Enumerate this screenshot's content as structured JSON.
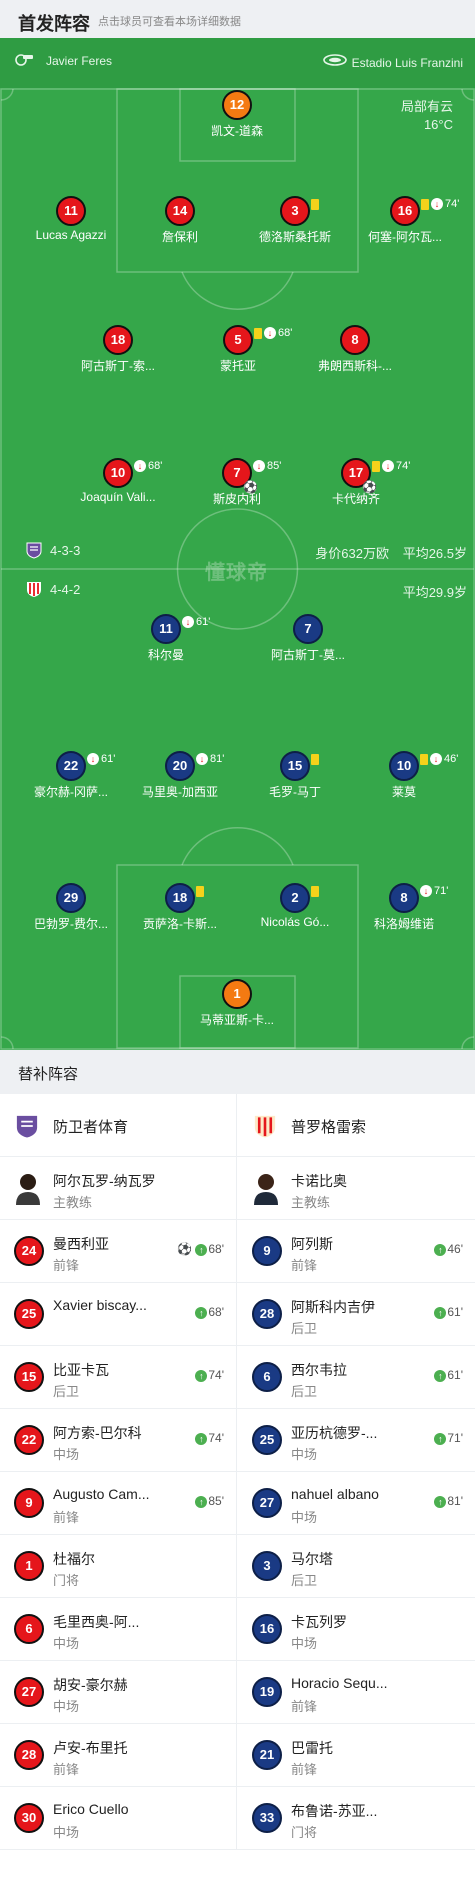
{
  "header": {
    "title": "首发阵容",
    "hint": "点击球员可查看本场详细数据"
  },
  "match_info": {
    "referee": "Javier Feres",
    "stadium": "Estadio Luis Franzini",
    "weather": "局部有云",
    "temperature": "16°C",
    "watermark": "懂球帝"
  },
  "home_team": {
    "name": "防卫者体育",
    "formation": "4-3-3",
    "value": "身价632万欧",
    "avg_age": "平均26.5岁",
    "color": "#e5161b"
  },
  "away_team": {
    "name": "普罗格雷索",
    "formation": "4-4-2",
    "avg_age": "平均29.9岁",
    "color": "#1a3a84"
  },
  "home_lineup": [
    {
      "number": "12",
      "name": "凯文-道森",
      "marks": ""
    },
    {
      "number": "11",
      "name": "Lucas Agazzi",
      "marks": ""
    },
    {
      "number": "14",
      "name": "詹保利",
      "marks": ""
    },
    {
      "number": "3",
      "name": "德洛斯桑托斯",
      "marks": ""
    },
    {
      "number": "16",
      "name": "何塞-阿尔瓦...",
      "marks": "74'"
    },
    {
      "number": "18",
      "name": "阿古斯丁-索...",
      "marks": ""
    },
    {
      "number": "5",
      "name": "蒙托亚",
      "marks": "68'"
    },
    {
      "number": "8",
      "name": "弗朗西斯科-...",
      "marks": ""
    },
    {
      "number": "10",
      "name": "Joaquín Vali...",
      "marks": "68'"
    },
    {
      "number": "7",
      "name": "斯皮内利",
      "marks": "85'"
    },
    {
      "number": "17",
      "name": "卡代纳齐",
      "marks": "74'"
    }
  ],
  "away_lineup": [
    {
      "number": "11",
      "name": "科尔曼",
      "marks": "61'"
    },
    {
      "number": "7",
      "name": "阿古斯丁-莫...",
      "marks": ""
    },
    {
      "number": "22",
      "name": "豪尔赫-冈萨...",
      "marks": "61'"
    },
    {
      "number": "20",
      "name": "马里奥-加西亚",
      "marks": "81'"
    },
    {
      "number": "15",
      "name": "毛罗-马丁",
      "marks": ""
    },
    {
      "number": "10",
      "name": "莱莫",
      "marks": "46'"
    },
    {
      "number": "29",
      "name": "巴勃罗-费尔...",
      "marks": ""
    },
    {
      "number": "18",
      "name": "贡萨洛-卡斯...",
      "marks": ""
    },
    {
      "number": "2",
      "name": "Nicolás Gó...",
      "marks": ""
    },
    {
      "number": "8",
      "name": "科洛姆维诺",
      "marks": "71'"
    },
    {
      "number": "1",
      "name": "马蒂亚斯-卡...",
      "marks": ""
    }
  ],
  "subs": {
    "title": "替补阵容",
    "home_coach": {
      "name": "阿尔瓦罗-纳瓦罗",
      "role": "主教练"
    },
    "away_coach": {
      "name": "卡诺比奥",
      "role": "主教练"
    },
    "home": [
      {
        "number": "24",
        "name": "曼西利亚",
        "pos": "前锋",
        "time": "68'"
      },
      {
        "number": "25",
        "name": "Xavier biscay...",
        "pos": "",
        "time": "68'"
      },
      {
        "number": "15",
        "name": "比亚卡瓦",
        "pos": "后卫",
        "time": "74'"
      },
      {
        "number": "22",
        "name": "阿方索-巴尔科",
        "pos": "中场",
        "time": "74'"
      },
      {
        "number": "9",
        "name": "Augusto Cam...",
        "pos": "前锋",
        "time": "85'"
      },
      {
        "number": "1",
        "name": "杜福尔",
        "pos": "门将",
        "time": ""
      },
      {
        "number": "6",
        "name": "毛里西奥-阿...",
        "pos": "中场",
        "time": ""
      },
      {
        "number": "27",
        "name": "胡安-豪尔赫",
        "pos": "中场",
        "time": ""
      },
      {
        "number": "28",
        "name": "卢安-布里托",
        "pos": "前锋",
        "time": ""
      },
      {
        "number": "30",
        "name": "Erico Cuello",
        "pos": "中场",
        "time": ""
      }
    ],
    "away": [
      {
        "number": "9",
        "name": "阿列斯",
        "pos": "前锋",
        "time": "46'"
      },
      {
        "number": "28",
        "name": "阿斯科内吉伊",
        "pos": "后卫",
        "time": "61'"
      },
      {
        "number": "6",
        "name": "西尔韦拉",
        "pos": "后卫",
        "time": "61'"
      },
      {
        "number": "25",
        "name": "亚历杭德罗-...",
        "pos": "中场",
        "time": "71'"
      },
      {
        "number": "27",
        "name": "nahuel albano",
        "pos": "中场",
        "time": "81'"
      },
      {
        "number": "3",
        "name": "马尔塔",
        "pos": "后卫",
        "time": ""
      },
      {
        "number": "16",
        "name": "卡瓦列罗",
        "pos": "中场",
        "time": ""
      },
      {
        "number": "19",
        "name": "Horacio Sequ...",
        "pos": "前锋",
        "time": ""
      },
      {
        "number": "21",
        "name": "巴雷托",
        "pos": "前锋",
        "time": ""
      },
      {
        "number": "33",
        "name": "布鲁诺-苏亚...",
        "pos": "门将",
        "time": ""
      }
    ]
  }
}
